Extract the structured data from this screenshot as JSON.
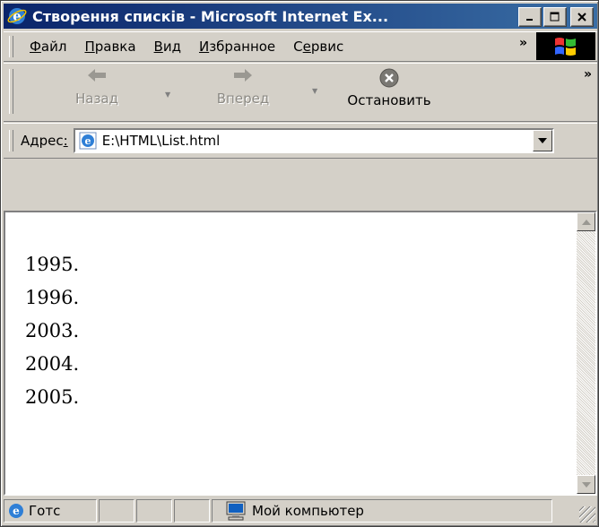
{
  "window": {
    "title": "Створення списків - Microsoft Internet Ex...",
    "controls": {
      "minimize": "_",
      "maximize": "□",
      "close": "✕"
    }
  },
  "menu": {
    "items": [
      {
        "accel": "Ф",
        "rest": "айл"
      },
      {
        "accel": "П",
        "rest": "равка"
      },
      {
        "accel": "В",
        "rest": "ид"
      },
      {
        "accel": "И",
        "rest": "збранное"
      },
      {
        "pre": "С",
        "accel": "е",
        "rest": "рвис"
      }
    ],
    "overflow": "»"
  },
  "toolbar": {
    "back_label": "Назад",
    "forward_label": "Вперед",
    "stop_label": "Остановить",
    "overflow": "»"
  },
  "address": {
    "label_pre": "Адрес",
    "label_accel": ":",
    "value": "E:\\HTML\\List.html"
  },
  "content": {
    "lines": [
      "1995.",
      "1996.",
      "2003.",
      "2004.",
      "2005."
    ]
  },
  "status": {
    "text": "Готс",
    "zone": "Мой компьютер"
  },
  "colors": {
    "title_start": "#0a246a",
    "title_end": "#3a6ea5",
    "face": "#d4d0c8"
  }
}
